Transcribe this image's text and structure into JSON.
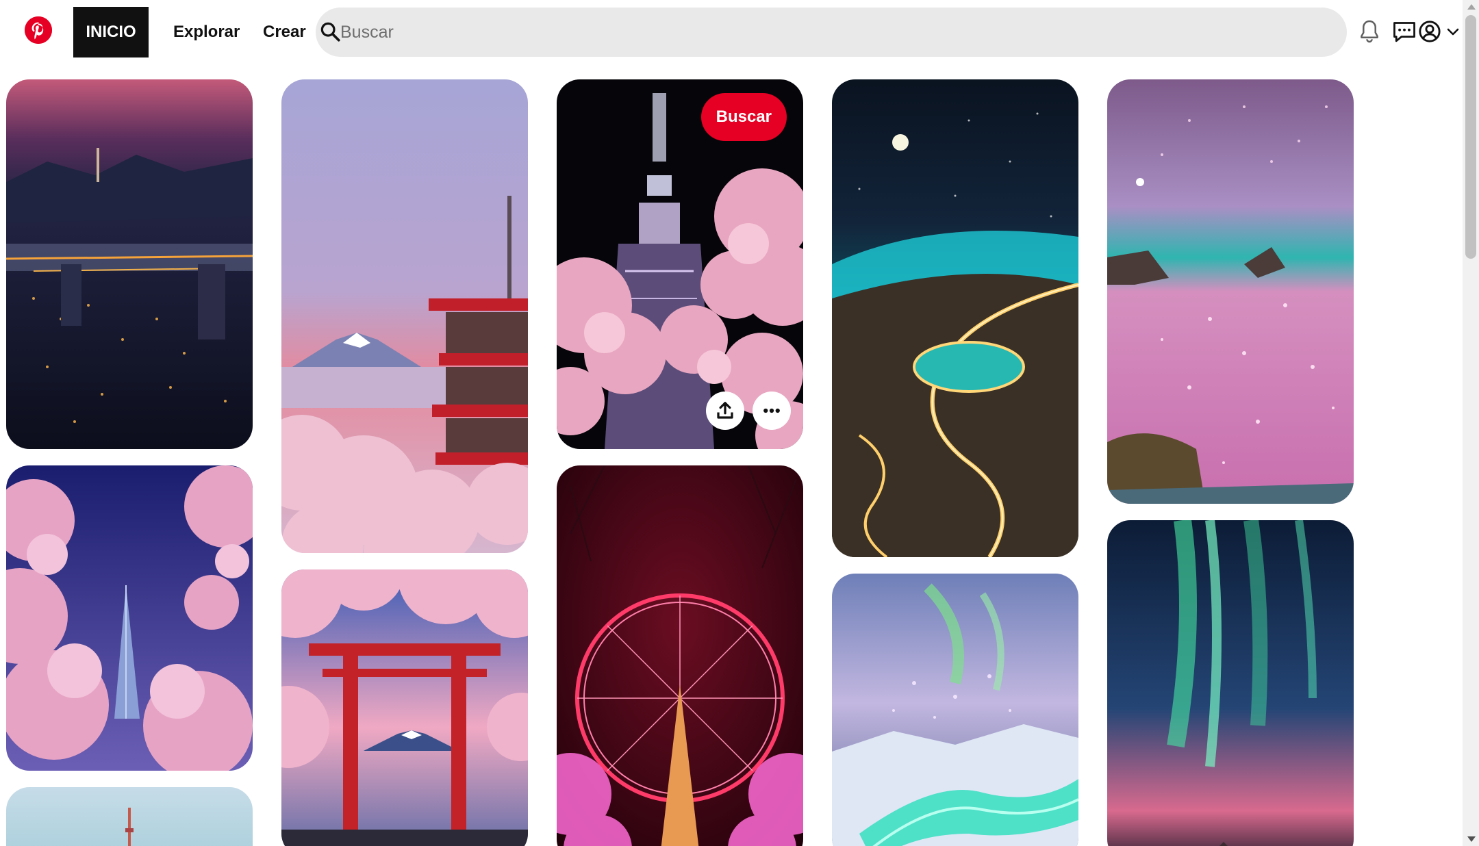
{
  "header": {
    "logo_icon": "pinterest-logo-icon",
    "brand_color": "#e60023",
    "nav": {
      "home_label": "INICIO",
      "explore_label": "Explorar",
      "create_label": "Crear"
    },
    "search": {
      "placeholder": "Buscar",
      "value": "",
      "icon": "search-icon"
    },
    "icons": [
      "bell-icon",
      "message-icon",
      "profile-icon",
      "chevron-down-icon"
    ]
  },
  "hovered_pin": {
    "save_label": "Buscar",
    "actions": [
      "share-icon",
      "more-icon"
    ]
  },
  "pins": [
    {
      "id": "seoul-night-city",
      "description": "Seoul night skyline with illuminated river and tower"
    },
    {
      "id": "lotte-tower-cherry-blossoms",
      "description": "Cherry blossoms framing a skyscraper at dusk"
    },
    {
      "id": "tokyo-tower-partial",
      "description": "Tower against pale sky"
    },
    {
      "id": "fuji-pagoda-sunset",
      "description": "Red pagoda with Mount Fuji and cherry blossoms"
    },
    {
      "id": "torii-fuji",
      "description": "Red torii gate framing Mount Fuji"
    },
    {
      "id": "skytree-blossoms",
      "description": "Illuminated tower behind cherry blossoms at night"
    },
    {
      "id": "pink-ferris-wheel",
      "description": "Glowing pink ferris wheel with lit trees"
    },
    {
      "id": "glowing-beach",
      "description": "Moonlit bioluminescent beach"
    },
    {
      "id": "aurora-snow-river",
      "description": "Aurora over glowing snowy river"
    },
    {
      "id": "pink-sparkle-beach",
      "description": "Pink glittering shoreline under starry sky"
    },
    {
      "id": "aurora-cabin",
      "description": "Green aurora over a snowy cabin"
    }
  ]
}
